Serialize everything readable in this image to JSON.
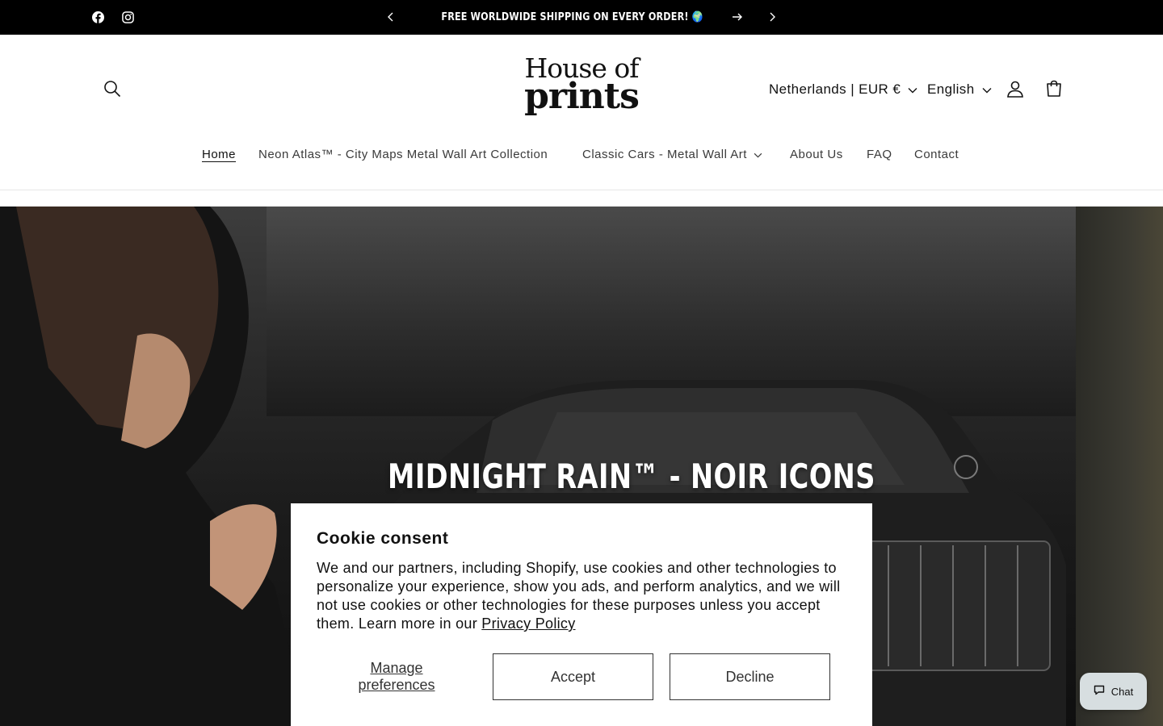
{
  "announcement": {
    "message": "Free worldwide shipping on every order! 🌍",
    "icons": [
      "facebook-icon",
      "instagram-icon",
      "chevron-left-icon",
      "chevron-right-icon",
      "arrow-right-icon"
    ]
  },
  "header": {
    "logo_line1": "House of",
    "logo_line2": "prints",
    "country_selector": "Netherlands | EUR €",
    "language_selector": "English",
    "icons": [
      "search-icon",
      "account-icon",
      "cart-icon",
      "chevron-down-icon"
    ]
  },
  "nav": {
    "items": [
      {
        "label": "Home",
        "active": true
      },
      {
        "label": "Neon Atlas™ - City Maps Metal Wall Art Collection"
      },
      {
        "label": "Classic Cars - Metal Wall Art",
        "has_dropdown": true
      },
      {
        "label": "About Us"
      },
      {
        "label": "FAQ"
      },
      {
        "label": "Contact"
      }
    ]
  },
  "hero": {
    "title": "Midnight Rain™ - Noir Icons"
  },
  "cookie": {
    "title": "Cookie consent",
    "text": "We and our partners, including Shopify, use cookies and other technologies to personalize your experience, show you ads, and perform analytics, and we will not use cookies or other technologies for these purposes unless you accept them. Learn more in our ",
    "policy_link": "Privacy Policy",
    "manage_label": "Manage preferences",
    "accept_label": "Accept",
    "decline_label": "Decline"
  },
  "chat": {
    "label": "Chat",
    "icon": "chat-bubble-icon"
  },
  "colors": {
    "announcement_bg": "#000000",
    "chat_bg": "#d7dee0"
  }
}
